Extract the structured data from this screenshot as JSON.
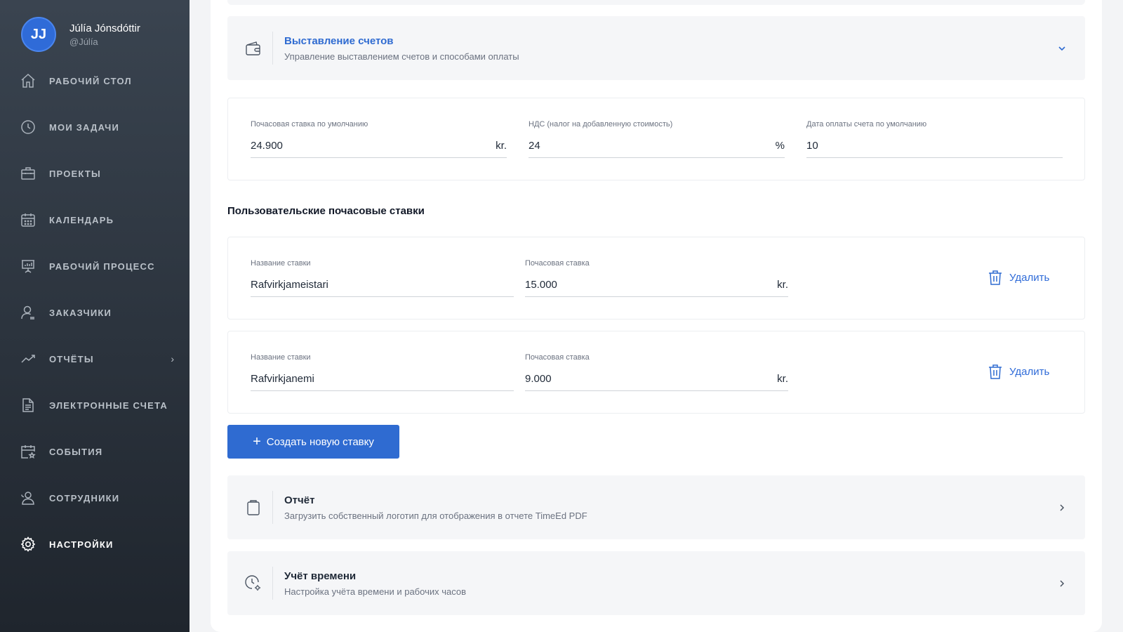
{
  "user": {
    "initials": "JJ",
    "name": "Júlía Jónsdóttir",
    "handle": "@Júlía"
  },
  "nav": [
    {
      "label": "РАБОЧИЙ СТОЛ",
      "icon": "home-icon"
    },
    {
      "label": "МОИ ЗАДАЧИ",
      "icon": "clock-icon"
    },
    {
      "label": "ПРОЕКТЫ",
      "icon": "briefcase-icon"
    },
    {
      "label": "КАЛЕНДАРЬ",
      "icon": "calendar-icon"
    },
    {
      "label": "РАБОЧИЙ ПРОЦЕСС",
      "icon": "presentation-icon"
    },
    {
      "label": "ЗАКАЗЧИКИ",
      "icon": "user-icon"
    },
    {
      "label": "ОТЧЁТЫ",
      "icon": "trend-icon"
    },
    {
      "label": "ЭЛЕКТРОННЫЕ СЧЕТА",
      "icon": "document-icon"
    },
    {
      "label": "СОБЫТИЯ",
      "icon": "calendar-star-icon"
    },
    {
      "label": "СОТРУДНИКИ",
      "icon": "users-icon"
    },
    {
      "label": "НАСТРОЙКИ",
      "icon": "gear-icon"
    }
  ],
  "billing": {
    "title": "Выставление счетов",
    "description": "Управление выставлением счетов и способами оплаты",
    "hourly_rate_label": "Почасовая ставка по умолчанию",
    "hourly_rate_value": "24.900",
    "hourly_rate_unit": "kr.",
    "vat_label": "НДС (налог на добавленную стоимость)",
    "vat_value": "24",
    "vat_unit": "%",
    "due_label": "Дата оплаты счета по умолчанию",
    "due_value": "10"
  },
  "custom_rates": {
    "heading": "Пользовательские почасовые ставки",
    "rows": [
      {
        "name_label": "Название ставки",
        "name": "Rafvirkjameistari",
        "rate_label": "Почасовая ставка",
        "rate": "15.000",
        "unit": "kr.",
        "delete": "Удалить"
      },
      {
        "name_label": "Название ставки",
        "name": "Rafvirkjanemi",
        "rate_label": "Почасовая ставка",
        "rate": "9.000",
        "unit": "kr.",
        "delete": "Удалить"
      }
    ],
    "create_label": "Создать новую ставку"
  },
  "report": {
    "title": "Отчёт",
    "description": "Загрузить собственный логотип для отображения в отчете TimeEd PDF"
  },
  "time_tracking": {
    "title": "Учёт времени",
    "description": "Настройка учёта времени и рабочих часов"
  },
  "colors": {
    "accent": "#2f6bd1",
    "sidebar": "#2b333d"
  }
}
